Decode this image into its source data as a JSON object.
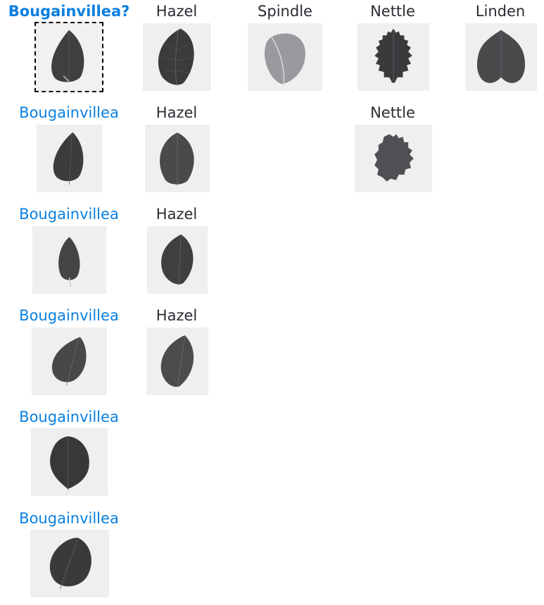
{
  "query": {
    "label": "Bougainvillea?",
    "icon": "leaf-image-bougainvillea"
  },
  "columns": [
    {
      "name": "Bougainvillea",
      "color": "#0a7fe0",
      "matches": 5
    },
    {
      "name": "Hazel",
      "color": "#2b2b33",
      "matches": 3
    },
    {
      "name": "Spindle",
      "color": "#2b2b33",
      "matches": 0
    },
    {
      "name": "Nettle",
      "color": "#2b2b33",
      "matches": 1
    },
    {
      "name": "Linden",
      "color": "#2b2b33",
      "matches": 0
    }
  ],
  "colors": {
    "match_label": "#0a7fe0",
    "other_label": "#2b2b33",
    "tile_background": "#efefef",
    "leaf_fill": "#3f3f42"
  }
}
